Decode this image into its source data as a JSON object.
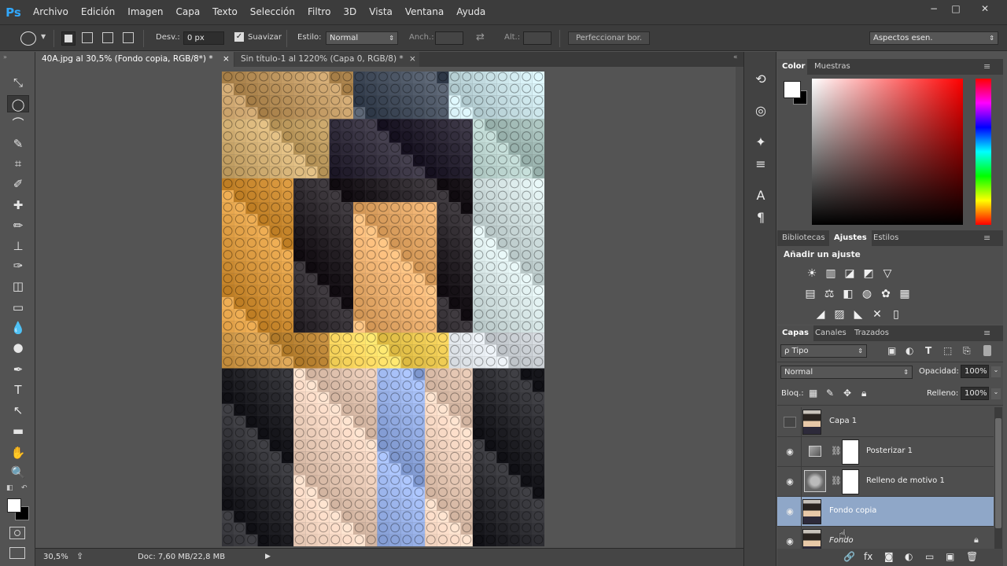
{
  "app": {
    "logo": "Ps"
  },
  "menu": [
    "Archivo",
    "Edición",
    "Imagen",
    "Capa",
    "Texto",
    "Selección",
    "Filtro",
    "3D",
    "Vista",
    "Ventana",
    "Ayuda"
  ],
  "window_controls": {
    "minimize": "−",
    "maximize": "□",
    "close": "✕"
  },
  "options": {
    "desv_label": "Desv.:",
    "desv_value": "0 px",
    "suavizar_label": "Suavizar",
    "estilo_label": "Estilo:",
    "estilo_value": "Normal",
    "anch_label": "Anch.:",
    "alt_label": "Alt.:",
    "perfeccionar_label": "Perfeccionar bor.",
    "workspace_value": "Aspectos esen."
  },
  "tabs": [
    {
      "label": "40A.jpg al 30,5% (Fondo copia, RGB/8*) *",
      "close": "×"
    },
    {
      "label": "Sin título-1 al 1220% (Capa 0, RGB/8) *",
      "close": "×"
    }
  ],
  "status": {
    "zoom": "30,5%",
    "doc": "Doc: 7,60 MB/22,8 MB",
    "arrow": "▶"
  },
  "color_panel": {
    "tabs": [
      "Color",
      "Muestras"
    ],
    "foreground": "#ffffff",
    "background": "#000000"
  },
  "adjust_panel": {
    "tabs": [
      "Bibliotecas",
      "Ajustes",
      "Estilos"
    ],
    "title": "Añadir un ajuste",
    "row1": [
      "☀",
      "▥",
      "◪",
      "◩",
      "▽"
    ],
    "row2": [
      "▤",
      "⚖",
      "◧",
      "◍",
      "✿",
      "▦"
    ],
    "row3": [
      "◢",
      "▨",
      "◣",
      "✕",
      "▯"
    ]
  },
  "layers_panel": {
    "tabs": [
      "Capas",
      "Canales",
      "Trazados"
    ],
    "filter_value": "Tipo",
    "filter_icon": "ρ",
    "blend_value": "Normal",
    "opacity_label": "Opacidad:",
    "opacity_value": "100%",
    "lock_label": "Bloq.:",
    "fill_label": "Relleno:",
    "fill_value": "100%",
    "layers": [
      {
        "name": "Capa 1",
        "visible": false,
        "kind": "photo"
      },
      {
        "name": "Posterizar 1",
        "visible": true,
        "kind": "adjust"
      },
      {
        "name": "Relleno de motivo 1",
        "visible": true,
        "kind": "pattern"
      },
      {
        "name": "Fondo copia",
        "visible": true,
        "kind": "photo",
        "selected": true
      },
      {
        "name": "Fondo",
        "visible": true,
        "kind": "photo",
        "locked": true
      }
    ],
    "bottom_icons": [
      "🔗",
      "fx",
      "◙",
      "◐",
      "▭",
      "▣",
      "🗑"
    ]
  },
  "icons": {
    "tools": [
      "move-icon",
      "elliptical-marquee-icon",
      "lasso-icon",
      "quick-selection-icon",
      "crop-icon",
      "eyedropper-icon",
      "healing-brush-icon",
      "brush-icon",
      "clone-stamp-icon",
      "history-brush-icon",
      "eraser-icon",
      "gradient-icon",
      "blur-icon",
      "dodge-icon",
      "pen-icon",
      "type-icon",
      "path-selection-icon",
      "rectangle-icon",
      "hand-icon",
      "zoom-icon"
    ],
    "tool_glyphs": [
      "⤡",
      "◯",
      "⌒",
      "✎",
      "⌗",
      "✐",
      "✚",
      "✏",
      "⊥",
      "✑",
      "◫",
      "▭",
      "💧",
      "●",
      "✒",
      "T",
      "↖",
      "▬",
      "✋",
      "🔍"
    ],
    "dock_glyphs": [
      "⟲",
      "◎",
      "✦",
      "≡",
      "A",
      "¶"
    ]
  }
}
